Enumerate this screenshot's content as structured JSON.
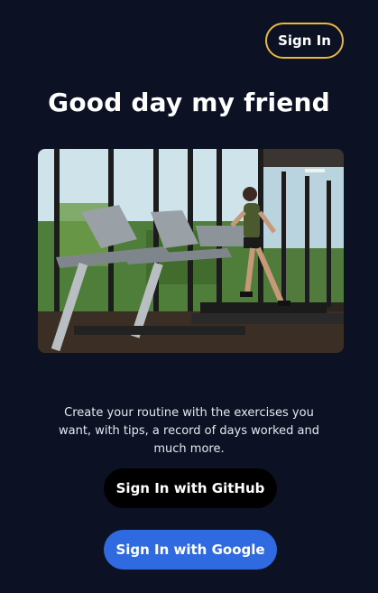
{
  "header": {
    "signin_label": "Sign In"
  },
  "main": {
    "title": "Good day my friend",
    "hero_image": "treadmill-gym-photo",
    "description": "Create your routine with the exercises you want, with tips, a record of days worked and much more.",
    "github_button_label": "Sign In with GitHub",
    "google_button_label": "Sign In with Google"
  },
  "colors": {
    "background": "#0c1224",
    "signin_border": "#e8b83a",
    "github_button": "#000000",
    "google_button": "#2f6ae0"
  }
}
